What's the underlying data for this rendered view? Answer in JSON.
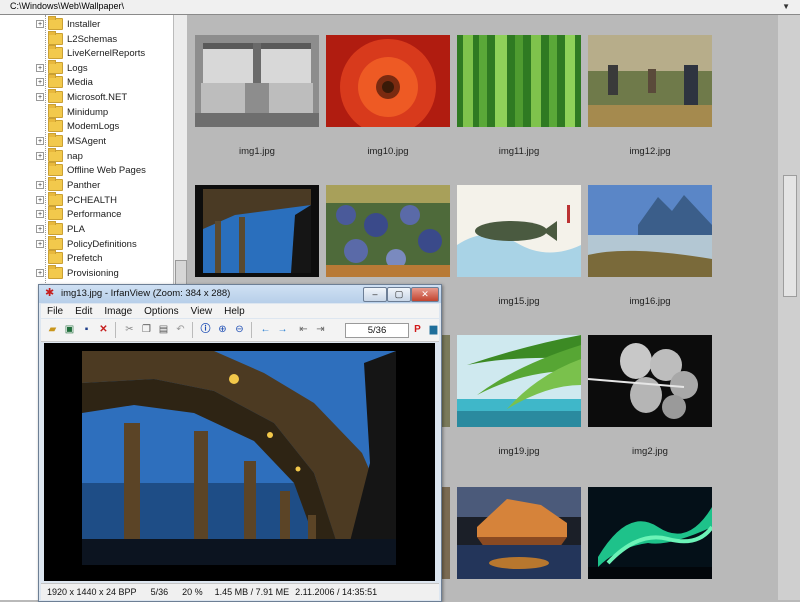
{
  "path_bar": {
    "path": "C:\\Windows\\Web\\Wallpaper\\"
  },
  "folder_tree": {
    "items": [
      {
        "label": "Installer"
      },
      {
        "label": "L2Schemas"
      },
      {
        "label": "LiveKernelReports"
      },
      {
        "label": "Logs"
      },
      {
        "label": "Media"
      },
      {
        "label": "Microsoft.NET"
      },
      {
        "label": "Minidump"
      },
      {
        "label": "ModemLogs"
      },
      {
        "label": "MSAgent"
      },
      {
        "label": "nap"
      },
      {
        "label": "Offline Web Pages"
      },
      {
        "label": "Panther"
      },
      {
        "label": "PCHEALTH"
      },
      {
        "label": "Performance"
      },
      {
        "label": "PLA"
      },
      {
        "label": "PolicyDefinitions"
      },
      {
        "label": "Prefetch"
      },
      {
        "label": "Provisioning"
      }
    ]
  },
  "thumbnails": [
    {
      "filename": "img1.jpg"
    },
    {
      "filename": "img10.jpg"
    },
    {
      "filename": "img11.jpg"
    },
    {
      "filename": "img12.jpg"
    },
    {
      "filename": ""
    },
    {
      "filename": ""
    },
    {
      "filename": "img15.jpg"
    },
    {
      "filename": "img16.jpg"
    },
    {
      "filename": ""
    },
    {
      "filename": ""
    },
    {
      "filename": "img19.jpg"
    },
    {
      "filename": "img2.jpg"
    },
    {
      "filename": ""
    },
    {
      "filename": ""
    },
    {
      "filename": ""
    },
    {
      "filename": ""
    }
  ],
  "viewer_window": {
    "title": "img13.jpg - IrfanView (Zoom: 384 x 288)",
    "menu": [
      "File",
      "Edit",
      "Image",
      "Options",
      "View",
      "Help"
    ],
    "page_counter": "5/36",
    "status": {
      "dimensions": "1920 x 1440 x 24 BPP",
      "index": "5/36",
      "zoom": "20 %",
      "size": "1.45 MB / 7.91 ME",
      "date": "2.11.2006 / 14:35:51"
    }
  }
}
